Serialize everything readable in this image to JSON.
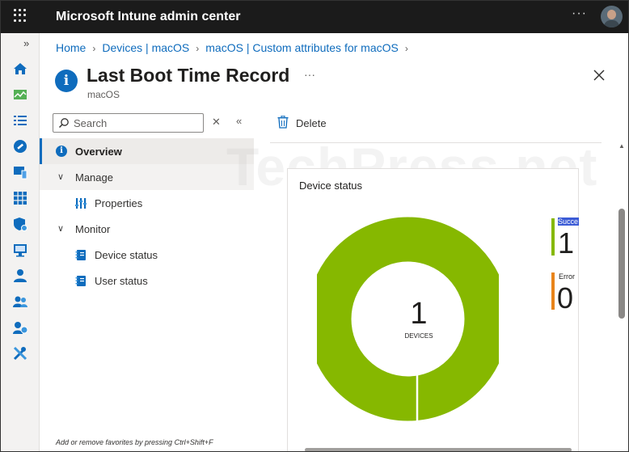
{
  "app": {
    "title": "Microsoft Intune admin center"
  },
  "topbar": {
    "more_label": "···"
  },
  "rail": {
    "expand_label": "»",
    "icons": [
      "home-icon",
      "dashboard-icon",
      "all-services-icon",
      "devices-icon",
      "apps-icon",
      "endpoint-security-icon",
      "reports-icon",
      "users-icon",
      "groups-icon",
      "tenant-admin-icon",
      "troubleshooting-icon"
    ]
  },
  "breadcrumb": {
    "items": [
      "Home",
      "Devices | macOS",
      "macOS | Custom attributes for macOS"
    ],
    "separator": "›"
  },
  "header": {
    "title": "Last Boot Time Record",
    "subtitle": "macOS",
    "more_label": "···"
  },
  "left_menu": {
    "search_placeholder": "Search",
    "clear_label": "✕",
    "collapse_label": "«",
    "overview_label": "Overview",
    "manage_label": "Manage",
    "properties_label": "Properties",
    "monitor_label": "Monitor",
    "device_status_label": "Device status",
    "user_status_label": "User status",
    "favorites_hint": "Add or remove favorites by pressing Ctrl+Shift+F"
  },
  "toolbar": {
    "delete_label": "Delete"
  },
  "watermark": "TechPress.net",
  "device_status_card": {
    "title": "Device status",
    "total": "1",
    "total_label": "DEVICES",
    "legend": [
      {
        "name": "Succe",
        "value": "1",
        "color": "#86b800"
      },
      {
        "name": "Error",
        "value": "0",
        "color": "#e8841a"
      }
    ]
  },
  "colors": {
    "accent": "#0f6cbd",
    "topbar": "#1b1b1b",
    "success": "#86b800",
    "error": "#e8841a"
  }
}
